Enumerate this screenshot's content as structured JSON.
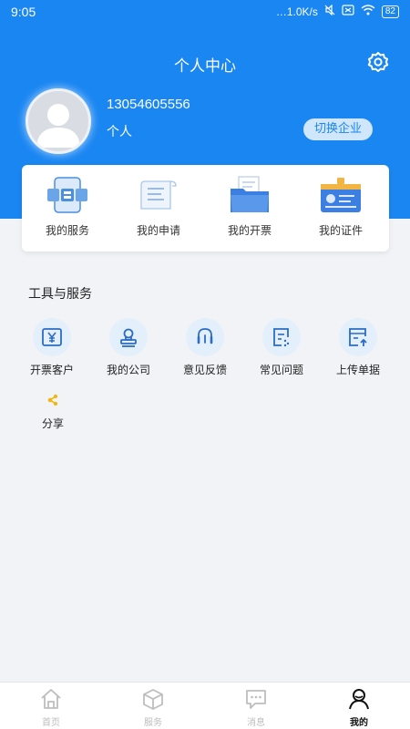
{
  "status_bar": {
    "time": "9:05",
    "network_speed": "1.0K/s",
    "battery": "82"
  },
  "header": {
    "title": "个人中心"
  },
  "profile": {
    "phone": "13054605556",
    "type": "个人",
    "switch_button": "切换企业"
  },
  "quick_actions": [
    {
      "label": "我的服务",
      "icon": "service-icon"
    },
    {
      "label": "我的申请",
      "icon": "application-icon"
    },
    {
      "label": "我的开票",
      "icon": "invoice-folder-icon"
    },
    {
      "label": "我的证件",
      "icon": "id-card-icon"
    }
  ],
  "tools": {
    "title": "工具与服务",
    "items": [
      {
        "label": "开票客户",
        "icon": "yuan-icon"
      },
      {
        "label": "我的公司",
        "icon": "stamp-icon"
      },
      {
        "label": "意见反馈",
        "icon": "headset-icon"
      },
      {
        "label": "常见问题",
        "icon": "faq-icon"
      },
      {
        "label": "上传单据",
        "icon": "upload-icon"
      }
    ],
    "share": {
      "label": "分享",
      "icon": "share-icon"
    }
  },
  "tabbar": {
    "items": [
      {
        "label": "首页",
        "icon": "home-icon"
      },
      {
        "label": "服务",
        "icon": "box-icon"
      },
      {
        "label": "消息",
        "icon": "message-icon"
      },
      {
        "label": "我的",
        "icon": "user-icon"
      }
    ],
    "active_index": 3
  },
  "colors": {
    "primary": "#1a86f2",
    "page_bg": "#f1f3f6",
    "switch_bg": "#cfe6fb",
    "share_accent": "#f5b50a"
  }
}
